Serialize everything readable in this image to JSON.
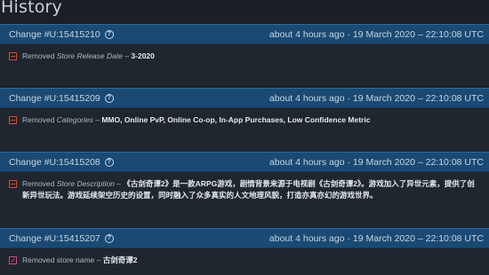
{
  "page": {
    "title": "History"
  },
  "changes": [
    {
      "id": "Change #U:15415210",
      "time": "about 4 hours ago · 19 March 2020 – 22:10:08 UTC",
      "action": "Removed",
      "field": "Store Release Date",
      "separator": " – ",
      "value": "3-2020"
    },
    {
      "id": "Change #U:15415209",
      "time": "about 4 hours ago · 19 March 2020 – 22:10:08 UTC",
      "action": "Removed",
      "field": "Categories",
      "separator": " – ",
      "value": "MMO, Online PvP, Online Co-op, In-App Purchases, Low Confidence Metric"
    },
    {
      "id": "Change #U:15415208",
      "time": "about 4 hours ago · 19 March 2020 – 22:10:08 UTC",
      "action": "Removed",
      "field": "Store Description",
      "separator": " – ",
      "value": "《古剑奇谭2》是一款ARPG游戏，剧情背景来源于电视剧《古剑奇谭2》。游戏加入了异世元素，提供了创新异世玩法。游戏延续架空历史的设置，同时融入了众多真实的人文地理风貌，打造亦真亦幻的游戏世界。"
    },
    {
      "id": "Change #U:15415207",
      "time": "about 4 hours ago · 19 March 2020 – 22:10:08 UTC",
      "action": "Removed store name",
      "field": "",
      "separator": " – ",
      "value": "古剑奇谭2"
    }
  ],
  "colors": {
    "background": "#1b2026",
    "header": "#1a4a74",
    "body": "#1f262e",
    "removed_icon": "#d24a4a",
    "name_icon": "#c94f8a"
  },
  "icons": {
    "help": "question-circle-icon",
    "removed": "minus-square-icon",
    "renamed": "pen-square-icon"
  }
}
